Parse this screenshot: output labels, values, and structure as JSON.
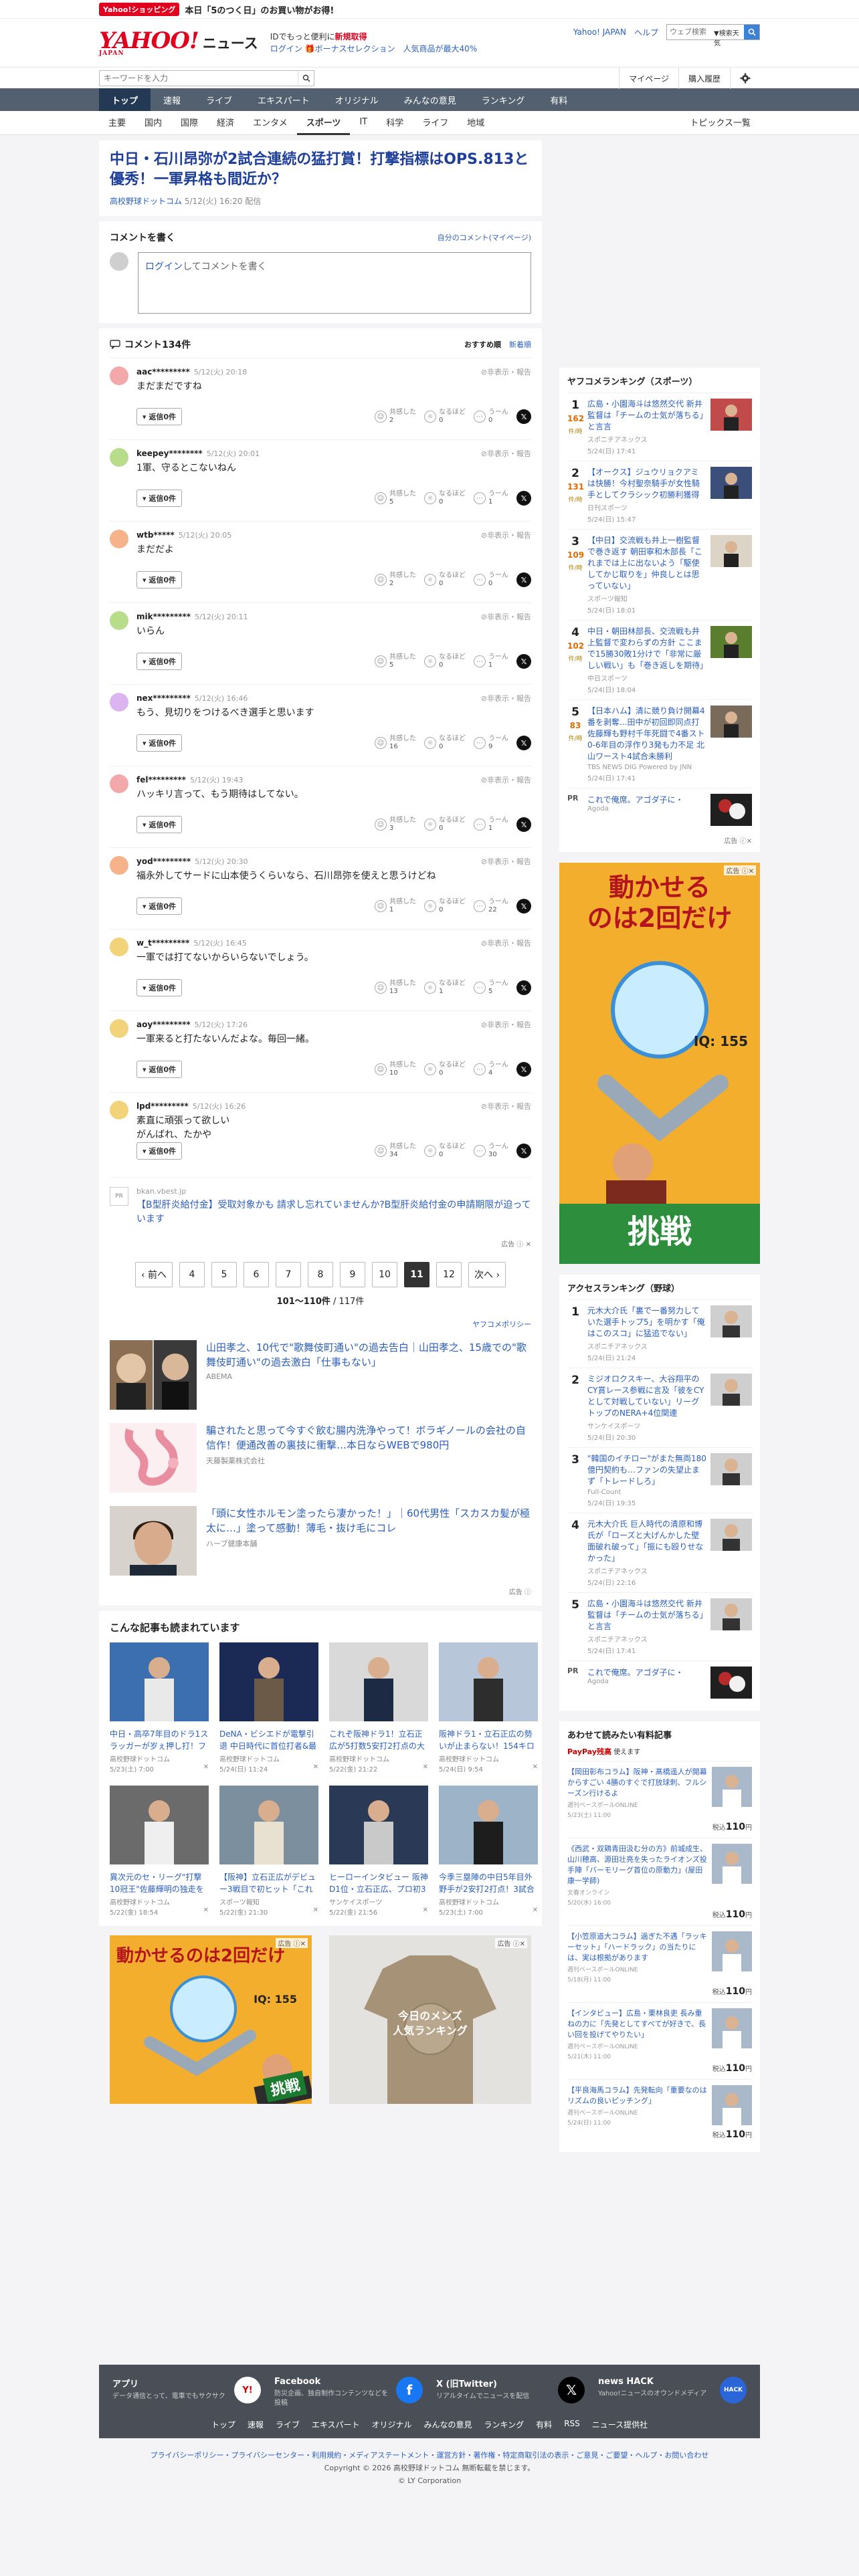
{
  "promo": {
    "badge": "Yahoo!ショッピング",
    "text": "本日「5のつく日」のお買い物がお得!"
  },
  "header": {
    "logo": "YAHOO!",
    "logo_sub": "JAPAN",
    "news": "ニュース",
    "id_line1_a": "IDでもっと便利に",
    "id_line1_b": "新規取得",
    "login": "ログイン",
    "bonus": "ボーナスセレクション",
    "bonus_desc": "人気商品が最大40%",
    "links": [
      "Yahoo! JAPAN",
      "ヘルプ"
    ],
    "search_placeholder": "ウェブ検索",
    "search_tag": "▼検索天気"
  },
  "search": {
    "placeholder": "キーワードを入力",
    "links": [
      "マイページ",
      "購入履歴"
    ]
  },
  "gnav": [
    "トップ",
    "速報",
    "ライブ",
    "エキスパート",
    "オリジナル",
    "みんなの意見",
    "ランキング",
    "有料"
  ],
  "cat": [
    "主要",
    "国内",
    "国際",
    "経済",
    "エンタメ",
    "スポーツ",
    "IT",
    "科学",
    "ライフ",
    "地域"
  ],
  "cat_right": "トピックス一覧",
  "article": {
    "title": "中日・石川昂弥が2試合連続の猛打賞！打撃指標はOPS.813と優秀！一軍昇格も間近か？",
    "source": "高校野球ドットコム",
    "date": "5/12(火) 16:20",
    "status": "配信"
  },
  "post": {
    "title": "コメントを書く",
    "my": "自分のコメント(マイページ)",
    "box_link": "ログイン",
    "box_text": "してコメントを書く"
  },
  "comments_head": {
    "title": "コメント134件",
    "sort_on": "おすすめ順",
    "sort_off": "新着順"
  },
  "comment_labels": {
    "hide": "非表示・報告",
    "reply": "返信0件",
    "empathize": "共感した",
    "agree": "なるほど",
    "hmm": "うーん",
    "x": "𝕏"
  },
  "comments": [
    {
      "user": "aac*********",
      "date": "5/12(火) 20:18",
      "text": "まだまだですね",
      "c1": "2",
      "c2": "0",
      "c3": "0"
    },
    {
      "user": "keepey********",
      "date": "5/12(火) 20:01",
      "text": "1軍、守るとこないねん",
      "c1": "5",
      "c2": "0",
      "c3": "1"
    },
    {
      "user": "wtb*****",
      "date": "5/12(火) 20:05",
      "text": "まだだよ",
      "c1": "2",
      "c2": "0",
      "c3": "0"
    },
    {
      "user": "mik*********",
      "date": "5/12(火) 20:11",
      "text": "いらん",
      "c1": "5",
      "c2": "0",
      "c3": "1"
    },
    {
      "user": "nex*********",
      "date": "5/12(火) 16:46",
      "text": "もう、見切りをつけるべき選手と思います",
      "c1": "16",
      "c2": "0",
      "c3": "9"
    },
    {
      "user": "fel*********",
      "date": "5/12(火) 19:43",
      "text": "ハッキリ言って、もう期待はしてない。",
      "c1": "3",
      "c2": "0",
      "c3": "1"
    },
    {
      "user": "yod*********",
      "date": "5/12(火) 20:30",
      "text": "福永外してサードに山本使うくらいなら、石川昂弥を使えと思うけどね",
      "c1": "1",
      "c2": "0",
      "c3": "22"
    },
    {
      "user": "w_t*********",
      "date": "5/12(火) 16:45",
      "text": "一軍では打てないからいらないでしょう。",
      "c1": "13",
      "c2": "1",
      "c3": "5"
    },
    {
      "user": "aoy*********",
      "date": "5/12(火) 17:26",
      "text": "一軍来ると打たないんだよな。毎回一緒。",
      "c1": "10",
      "c2": "0",
      "c3": "4"
    },
    {
      "user": "lpd*********",
      "date": "5/12(火) 16:26",
      "text": "素直に頑張って欲しい\nがんばれ、たかや",
      "c1": "34",
      "c2": "0",
      "c3": "30"
    }
  ],
  "ad_row": {
    "pr": "PR",
    "domain": "bkan.vbest.jp",
    "title": "【B型肝炎給付金】受取対象かも 請求し忘れていませんか?B型肝炎給付金の申請期限が迫っています",
    "label": "広告"
  },
  "pager": {
    "prev": "‹ 前へ",
    "next": "次へ ›",
    "pages": [
      "4",
      "5",
      "6",
      "7",
      "8",
      "9",
      "10",
      "11",
      "12"
    ],
    "current": "11",
    "count": "101〜110件",
    "total": "/ 117件",
    "policy": "ヤフコメポリシー"
  },
  "sponsored": [
    {
      "title": "山田孝之、10代で\"歌舞伎町通い\"の過去告白｜山田孝之、15歳での\"歌舞伎町通い\"の過去激白「仕事もない」",
      "src": "ABEMA"
    },
    {
      "title": "騙されたと思って今すぐ飲む腸内洗浄やって！ボラギノールの会社の自信作！便通改善の裏技に衝撃…本日ならWEBで980円",
      "src": "天藤製薬株式会社"
    },
    {
      "title": "「頭に女性ホルモン塗ったら凄かった！」｜60代男性「スカスカ髪が極太に…」塗って感動！薄毛・抜け毛にコレ",
      "src": "ハーブ健康本舗"
    }
  ],
  "sponsored_label": "広告",
  "grid": {
    "title": "こんな記事も読まれています",
    "items": [
      {
        "title": "中日・高卒7年目のドラ1スラッガーが岁ぇ押し打！ファンの期…",
        "src": "高校野球ドットコム",
        "date": "5/23(土) 7:00"
      },
      {
        "title": "DeNA・ビシエドが電撃引退 中日時代に首位打者&最多安打の2…",
        "src": "高校野球ドットコム",
        "date": "5/24(日) 11:24"
      },
      {
        "title": "これぞ阪神ドラ1！立石正広が5打数5安打2打点の大活躍で打…",
        "src": "高校野球ドットコム",
        "date": "5/22(金) 21:22"
      },
      {
        "title": "阪神ドラ1・立石正広の勢いが止まらない！154キロを弾き返す2…",
        "src": "高校野球ドットコム",
        "date": "5/24(日) 9:54"
      },
      {
        "title": "異次元のセ・リーグ\"打撃10冠王\"佐藤輝明の独走を止めるのはど…",
        "src": "高校野球ドットコム",
        "date": "5/22(金) 18:54"
      },
      {
        "title": "【阪神】立石正広がデビュー3戦目で初ヒット「これからも押…",
        "src": "スポーツ報知",
        "date": "5/22(金) 21:30"
      },
      {
        "title": "ヒーローインタビュー 阪神D1位・立石正広、プロ初3安打猛打賞…",
        "src": "サンケイスポーツ",
        "date": "5/22(金) 21:56"
      },
      {
        "title": "今季三塁陣の中日5年目外野手が2安打2打点！3試合ぶりスタメ…",
        "src": "高校野球ドットコム",
        "date": "5/23(土) 7:00"
      }
    ]
  },
  "bottom_ads": {
    "a1": "動かせるのは2回だけ",
    "a1_sub": "IQ: 155",
    "a1_btn": "挑戦",
    "a2_line1": "今日のメンズ",
    "a2_line2": "人気ランキング",
    "label": "広告"
  },
  "right": {
    "ranking_title": "ヤフコメランキング（スポーツ）",
    "ranking": [
      {
        "n": "1",
        "count": "162",
        "unit": "件/時",
        "title": "広島・小園海斗は悠然交代 新井監督は「チームの士気が落ちる」と言言",
        "src": "スポニチアネックス",
        "date": "5/24(日) 17:41"
      },
      {
        "n": "2",
        "count": "131",
        "unit": "件/時",
        "title": "【オークス】ジュウリョクアミは快勝！今村聖奈騎手が女性騎手としてクラシック初勝利獲得",
        "src": "日刊スポーツ",
        "date": "5/24(日) 15:47"
      },
      {
        "n": "3",
        "count": "109",
        "unit": "件/時",
        "title": "【中日】交流戦も井上一樹監督で巻き返す 朝田寧和木部長「これまでは上に出ないよう「駆使してかじ取りを」仲良しとは思っていない」",
        "src": "スポーツ報知",
        "date": "5/24(日) 18:01"
      },
      {
        "n": "4",
        "count": "102",
        "unit": "件/時",
        "title": "中日・朝田林部長、交流戦も井上監督で変わらずの方針 ここまで15勝30敗1分けで「非常に厳しい戦い」も「巻き返しを期待」",
        "src": "中日スポーツ",
        "date": "5/24(日) 18:04"
      },
      {
        "n": "5",
        "count": "83",
        "unit": "件/時",
        "title": "【日本ハム】清に競り負け開幕4番を剥奪...田中が初回即同点打 佐藤輝も野村千年死闘で4番スト0-6年目の浮作り3発も力不足 北山ワースト4試合未勝利",
        "src": "TBS NEWS DIG Powered by JNN",
        "date": "5/24(日) 17:41"
      }
    ],
    "pr": {
      "n": "PR",
      "title": "これで俺席。アゴダ子に・",
      "src": "Agoda"
    },
    "ad_label": "広告",
    "ad": {
      "line1": "動かせる",
      "line2": "のは2回だけ",
      "iq": "IQ: 155",
      "btn": "挑戦"
    },
    "access_title": "アクセスランキング（野球）",
    "access": [
      {
        "n": "1",
        "title": "元木大介氏「裏で一番努力していた選手トップ5」を明かす「俺はこのスコ」に猛追でない」",
        "src": "スポニチアネックス",
        "date": "5/24(日) 21:24"
      },
      {
        "n": "2",
        "title": "ミジオロクスキー、大谷翔平のCY賞レース参戦に言及「彼をCYとして対戦していない」リーグトップのNERA+4位関連",
        "src": "サンケイスポーツ",
        "date": "5/24(日) 20:30"
      },
      {
        "n": "3",
        "title": "\"韓国のイチロー\"がまた無両180億円契約も…ファンの失望止まず「トレードしろ」",
        "src": "Full-Count",
        "date": "5/24(日) 19:35"
      },
      {
        "n": "4",
        "title": "元木大介氏 巨人時代の清原和博氏が「ローズと大げんかした壁面破れ破って」「振にも殴りせなかった」",
        "src": "スポニチアネックス",
        "date": "5/24(日) 22:16"
      },
      {
        "n": "5",
        "title": "広島・小園海斗は悠然交代 新井監督は「チームの士気が落ちる」と言言",
        "src": "スポニチアネックス",
        "date": "5/24(日) 17:41"
      }
    ],
    "access_pr": {
      "n": "PR",
      "title": "これで俺席。アゴダ子に・",
      "src": "Agoda"
    },
    "paid_title": "あわせて読みたい有料記事",
    "paid_badge": "PayPay残高",
    "paid_badge_desc": "使えます",
    "paid": [
      {
        "title": "【岡田彰布コラム】阪神・髙橋遥人が開幕からすごい 4勝のすぐで打放球刺、フルシーズン行けるよ",
        "src": "週刊ベースボールONLINE",
        "date": "5/23(土) 11:00",
        "price": "110"
      },
      {
        "title": "《西武・双鶏青田汲む分の方》前城成生、山川穂高、源田壮亮を失ったライオンズ投手陣「バーモリーグ首位の原動力」(屋田康一学師)",
        "src": "文春オンライン",
        "date": "5/20(水) 16:00",
        "price": "110"
      },
      {
        "title": "【小笠原道大コラム】過ぎた不遇「ラッキーセット」「ハードラック」の当たりには、実は根拠があります",
        "src": "週刊ベースボールONLINE",
        "date": "5/18(月) 11:00",
        "price": "110"
      },
      {
        "title": "【インタビュー】広島・栗林良吏 長み重ねの力に「先発としてすべてが好きで、長い回を投げてやりたい」",
        "src": "週刊ベースボールONLINE",
        "date": "5/21(木) 11:00",
        "price": "110"
      },
      {
        "title": "【平良海馬コラム】先発転向「重要なのはリズムの良いピッチング」",
        "src": "週刊ベースボールONLINE",
        "date": "5/24(日) 11:00",
        "price": "110"
      }
    ],
    "tax_prefix": "税込"
  },
  "footer": {
    "apps": [
      {
        "h": "アプリ",
        "d": "データ通信とって、電車でもサクサク"
      },
      {
        "h": "Facebook",
        "d": "防災企画、独自制作コンテンツなどを投稿"
      },
      {
        "h": "X (旧Twitter)",
        "d": "リアルタイムでニュースを配信"
      },
      {
        "h": "news HACK",
        "d": "Yahoo!ニュースのオウンドメディア"
      }
    ],
    "icons": [
      "Y!",
      "f",
      "𝕏",
      "HACK"
    ],
    "links": [
      "トップ",
      "速報",
      "ライブ",
      "エキスパート",
      "オリジナル",
      "みんなの意見",
      "ランキング",
      "有料",
      "RSS",
      "ニュース提供社"
    ],
    "bottom_links": "プライバシーポリシー・プライバシーセンター・利用規約・メディアステートメント・運営方針・著作権・特定商取引法の表示・ご意見・ご要望・ヘルプ・お問い合わせ",
    "copyright": "Copyright © 2026 高校野球ドットコム 無断転載を禁じます。",
    "corp": "© LY Corporation"
  }
}
